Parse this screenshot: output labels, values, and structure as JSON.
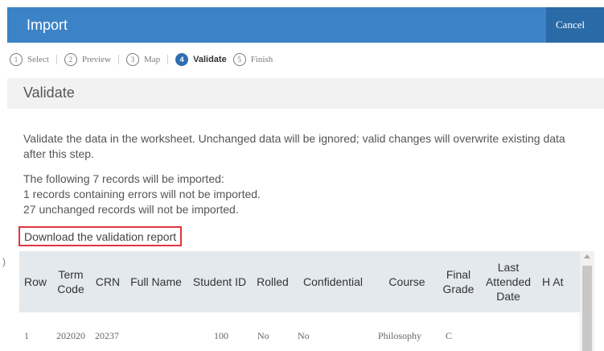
{
  "header": {
    "title": "Import",
    "cancel_label": "Cancel"
  },
  "steps": [
    {
      "num": "1",
      "label": "Select"
    },
    {
      "num": "2",
      "label": "Preview"
    },
    {
      "num": "3",
      "label": "Map"
    },
    {
      "num": "4",
      "label": "Validate"
    },
    {
      "num": "5",
      "label": "Finish"
    }
  ],
  "section": {
    "title": "Validate"
  },
  "body": {
    "intro": "Validate the data in the worksheet. Unchanged data will be ignored; valid changes will overwrite existing data after this step.",
    "summary_1": "The following 7 records will be imported:",
    "summary_2": "1 records containing errors will not be imported.",
    "summary_3": "27 unchanged records will not be imported.",
    "download_link": "Download the validation report"
  },
  "side_mark": ")",
  "table": {
    "headers": [
      "Row",
      "Term Code",
      "CRN",
      "Full Name",
      "Student ID",
      "Rolled",
      "Confidential",
      "Course",
      "Final Grade",
      "Last Attended Date",
      "H At"
    ],
    "rows": [
      [
        "1",
        "202020",
        "20237",
        "",
        "100",
        "No",
        "No",
        "Philosophy",
        "C",
        "",
        ""
      ]
    ]
  }
}
